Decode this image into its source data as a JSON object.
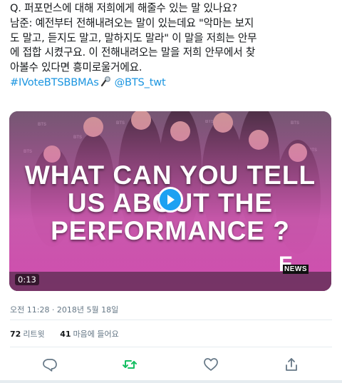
{
  "tweet": {
    "lines": [
      "Q. 퍼포먼스에 대해 저희에게 해줄수 있는 말 있나요?",
      "남준: 예전부터 전해내려오는 말이 있는데요 \"악마는 보지",
      "도 말고, 듣지도 말고, 말하지도 말라\" 이 말을 저희는 안무",
      "에 접합 시켰구요. 이 전해내려오는 말을 저희 안무에서 찾",
      "아볼수 있다면 흥미로울거에요."
    ],
    "hashtag": "#IVoteBTSBBMAs",
    "mention": "@BTS_twt",
    "hashtag_emoji": "microphone-icon"
  },
  "media": {
    "headline_lines": [
      "WHAT CAN YOU TELL",
      "US ABOUT THE",
      "PERFORMANCE ?"
    ],
    "duration": "0:13",
    "logo_letter": "E",
    "logo_text": "NEWS",
    "backdrop_label": "BTS",
    "tint_color": "#e05fbf"
  },
  "timestamp": "오전 11:28 · 2018년 5월 18일",
  "stats": {
    "retweets_count": "72",
    "retweets_label": "리트윗",
    "likes_count": "41",
    "likes_label": "마음에 들어요"
  },
  "actions": {
    "reply_icon": "reply-icon",
    "retweet_icon": "retweet-icon",
    "like_icon": "heart-icon",
    "share_icon": "share-icon",
    "retweet_color": "#17bf63",
    "icon_color": "#657786"
  },
  "colors": {
    "link": "#1b95e0",
    "text": "#14171a",
    "muted": "#657786",
    "play": "#1da1f2"
  }
}
